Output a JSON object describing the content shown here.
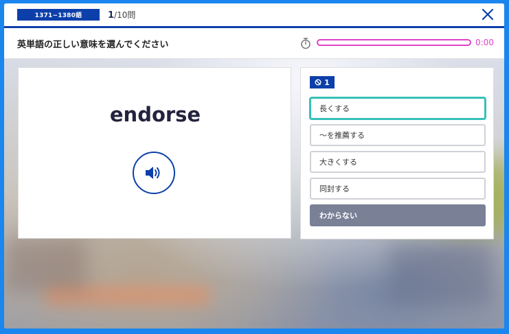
{
  "header": {
    "range_badge": "1371~1380語",
    "current": "1",
    "total": "/10問",
    "close_icon": "close-icon"
  },
  "question": {
    "instruction": "英単語の正しい意味を選んでください",
    "timer_text": "0:00",
    "timer_progress": 0,
    "timer_icon": "stopwatch-icon",
    "number": "1"
  },
  "word_card": {
    "word": "endorse",
    "speaker_icon": "speaker-icon"
  },
  "choices": [
    {
      "label": "長くする",
      "selected": true
    },
    {
      "label": "〜を推薦する",
      "selected": false
    },
    {
      "label": "大きくする",
      "selected": false
    },
    {
      "label": "同封する",
      "selected": false
    }
  ],
  "unknown_label": "わからない",
  "colors": {
    "brand": "#0c3fa9",
    "frame": "#1a86ee",
    "timer": "#e040c8",
    "selected": "#35c0b8",
    "unknown_bg": "#7a8096"
  }
}
